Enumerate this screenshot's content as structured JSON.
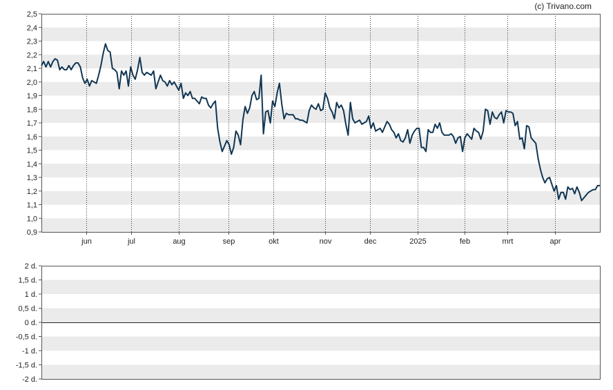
{
  "copyright": "(c) Trivano.com",
  "colors": {
    "line": "#0f3553",
    "band": "#ebebeb",
    "frame": "#555555",
    "zero_line": "#222222"
  },
  "chart_data": [
    {
      "type": "line",
      "name": "price-panel",
      "title": "",
      "xlabel": "",
      "ylabel": "",
      "ylim": [
        0.9,
        2.5
      ],
      "grid": "alternating horizontal bands, dotted vertical month lines",
      "y_ticks": [
        "2,5",
        "2,4",
        "2,3",
        "2,2",
        "2,1",
        "2,0",
        "1,9",
        "1,8",
        "1,7",
        "1,6",
        "1,5",
        "1,4",
        "1,3",
        "1,2",
        "1,1",
        "1,0",
        "0,9"
      ],
      "y_tick_values": [
        2.5,
        2.4,
        2.3,
        2.2,
        2.1,
        2.0,
        1.9,
        1.8,
        1.7,
        1.6,
        1.5,
        1.4,
        1.3,
        1.2,
        1.1,
        1.0,
        0.9
      ],
      "x_ticks": [
        "jun",
        "jul",
        "aug",
        "sep",
        "okt",
        "nov",
        "dec",
        "2025",
        "feb",
        "mrt",
        "apr"
      ],
      "x_tick_positions": [
        20,
        40,
        61,
        83,
        103,
        126,
        146,
        167,
        188,
        207,
        228
      ],
      "x_range": [
        0,
        248
      ],
      "series": [
        {
          "values": [
            2.12,
            2.15,
            2.11,
            2.15,
            2.11,
            2.15,
            2.17,
            2.16,
            2.09,
            2.11,
            2.09,
            2.09,
            2.12,
            2.09,
            2.12,
            2.14,
            2.14,
            2.11,
            2.03,
            1.99,
            2.02,
            1.97,
            2.01,
            2.0,
            1.99,
            2.05,
            2.12,
            2.21,
            2.28,
            2.23,
            2.22,
            2.1,
            2.09,
            2.07,
            1.95,
            2.08,
            2.05,
            2.08,
            1.97,
            2.11,
            2.05,
            2.02,
            2.09,
            2.18,
            2.07,
            2.05,
            2.07,
            2.06,
            2.05,
            2.08,
            1.95,
            2.0,
            2.05,
            2.01,
            2.0,
            1.97,
            2.01,
            1.98,
            2.0,
            1.97,
            1.94,
            1.99,
            1.88,
            1.92,
            1.9,
            1.93,
            1.88,
            1.88,
            1.86,
            1.84,
            1.89,
            1.88,
            1.88,
            1.83,
            1.81,
            1.84,
            1.86,
            1.66,
            1.56,
            1.49,
            1.53,
            1.57,
            1.54,
            1.47,
            1.52,
            1.64,
            1.61,
            1.54,
            1.72,
            1.82,
            1.77,
            1.81,
            1.9,
            1.93,
            1.87,
            1.88,
            2.05,
            1.62,
            1.78,
            1.79,
            1.7,
            1.86,
            1.82,
            1.92,
            1.99,
            1.84,
            1.73,
            1.77,
            1.76,
            1.76,
            1.76,
            1.73,
            1.73,
            1.72,
            1.72,
            1.71,
            1.7,
            1.79,
            1.83,
            1.81,
            1.8,
            1.84,
            1.79,
            1.8,
            1.92,
            1.88,
            1.81,
            1.78,
            1.73,
            1.85,
            1.81,
            1.83,
            1.79,
            1.69,
            1.61,
            1.85,
            1.73,
            1.7,
            1.71,
            1.72,
            1.69,
            1.7,
            1.71,
            1.75,
            1.66,
            1.7,
            1.64,
            1.65,
            1.66,
            1.63,
            1.67,
            1.71,
            1.69,
            1.65,
            1.63,
            1.59,
            1.62,
            1.57,
            1.56,
            1.59,
            1.65,
            1.55,
            1.61,
            1.64,
            1.66,
            1.66,
            1.52,
            1.52,
            1.49,
            1.65,
            1.63,
            1.63,
            1.69,
            1.66,
            1.7,
            1.63,
            1.61,
            1.61,
            1.61,
            1.62,
            1.6,
            1.55,
            1.59,
            1.6,
            1.49,
            1.59,
            1.62,
            1.6,
            1.58,
            1.66,
            1.64,
            1.63,
            1.58,
            1.64,
            1.8,
            1.79,
            1.69,
            1.78,
            1.74,
            1.73,
            1.76,
            1.78,
            1.7,
            1.79,
            1.78,
            1.78,
            1.77,
            1.68,
            1.71,
            1.58,
            1.59,
            1.51,
            1.68,
            1.67,
            1.59,
            1.57,
            1.55,
            1.44,
            1.36,
            1.3,
            1.26,
            1.29,
            1.3,
            1.25,
            1.2,
            1.24,
            1.14,
            1.19,
            1.19,
            1.14,
            1.23,
            1.21,
            1.22,
            1.18,
            1.23,
            1.19,
            1.13,
            1.15,
            1.17,
            1.19,
            1.2,
            1.21,
            1.21,
            1.24,
            1.24
          ]
        }
      ]
    },
    {
      "type": "line",
      "name": "dividend-panel",
      "title": "",
      "xlabel": "",
      "ylabel": "",
      "ylim": [
        -2,
        2
      ],
      "grid": "alternating horizontal bands",
      "y_ticks": [
        "2 d.",
        "1,5 d.",
        "1 d.",
        "0,5 d.",
        "0 d.",
        "-0,5 d.",
        "-1 d.",
        "-1,5 d.",
        "-2 d."
      ],
      "y_tick_values": [
        2,
        1.5,
        1,
        0.5,
        0,
        -0.5,
        -1,
        -1.5,
        -2
      ],
      "series": []
    }
  ]
}
